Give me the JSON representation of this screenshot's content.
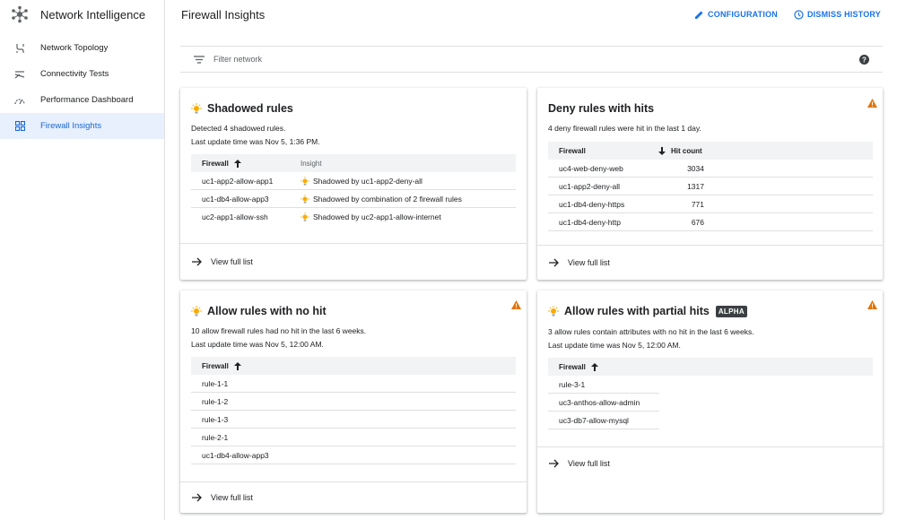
{
  "app": {
    "name": "Network Intelligence",
    "nav": [
      {
        "label": "Network Topology",
        "icon": "topology-icon"
      },
      {
        "label": "Connectivity Tests",
        "icon": "connectivity-icon"
      },
      {
        "label": "Performance Dashboard",
        "icon": "gauge-icon"
      },
      {
        "label": "Firewall Insights",
        "icon": "grid-icon",
        "active": true
      }
    ]
  },
  "header": {
    "title": "Firewall Insights",
    "configuration_label": "CONFIGURATION",
    "dismiss_history_label": "DISMISS HISTORY"
  },
  "filter": {
    "placeholder": "Filter network"
  },
  "colors": {
    "accent": "#1a73e8",
    "active_bg": "#e8f0fe",
    "warning": "#e37400",
    "bulb": "#f9ab00"
  },
  "cards": {
    "shadowed": {
      "title": "Shadowed rules",
      "desc1": "Detected 4 shadowed rules.",
      "desc2": "Last update time was Nov 5, 1:36 PM.",
      "col_firewall": "Firewall",
      "col_insight": "Insight",
      "rows": [
        {
          "firewall": "uc1-app2-allow-app1",
          "insight": "Shadowed by uc1-app2-deny-all"
        },
        {
          "firewall": "uc1-db4-allow-app3",
          "insight": "Shadowed by combination of 2 firewall rules"
        },
        {
          "firewall": "uc2-app1-allow-ssh",
          "insight": "Shadowed by uc2-app1-allow-internet"
        }
      ],
      "footer": "View full list"
    },
    "deny": {
      "title": "Deny rules with hits",
      "desc1": "4 deny firewall rules were hit in the last 1 day.",
      "col_firewall": "Firewall",
      "col_hits": "Hit count",
      "rows": [
        {
          "firewall": "uc4-web-deny-web",
          "hits": "3034"
        },
        {
          "firewall": "uc1-app2-deny-all",
          "hits": "1317"
        },
        {
          "firewall": "uc1-db4-deny-https",
          "hits": "771"
        },
        {
          "firewall": "uc1-db4-deny-http",
          "hits": "676"
        }
      ],
      "footer": "View full list"
    },
    "nohit": {
      "title": "Allow rules with no hit",
      "desc1": "10 allow firewall rules had no hit in the last 6 weeks.",
      "desc2": "Last update time was Nov 5, 12:00 AM.",
      "col_firewall": "Firewall",
      "rows": [
        "rule-1-1",
        "rule-1-2",
        "rule-1-3",
        "rule-2-1",
        "uc1-db4-allow-app3"
      ],
      "footer": "View full list"
    },
    "partial": {
      "title": "Allow rules with partial hits",
      "badge": "ALPHA",
      "desc1": "3 allow rules contain attributes with no hit in the last 6 weeks.",
      "desc2": "Last update time was Nov 5, 12:00 AM.",
      "col_firewall": "Firewall",
      "rows": [
        "rule-3-1",
        "uc3-anthos-allow-admin",
        "uc3-db7-allow-mysql"
      ],
      "footer": "View full list"
    }
  }
}
